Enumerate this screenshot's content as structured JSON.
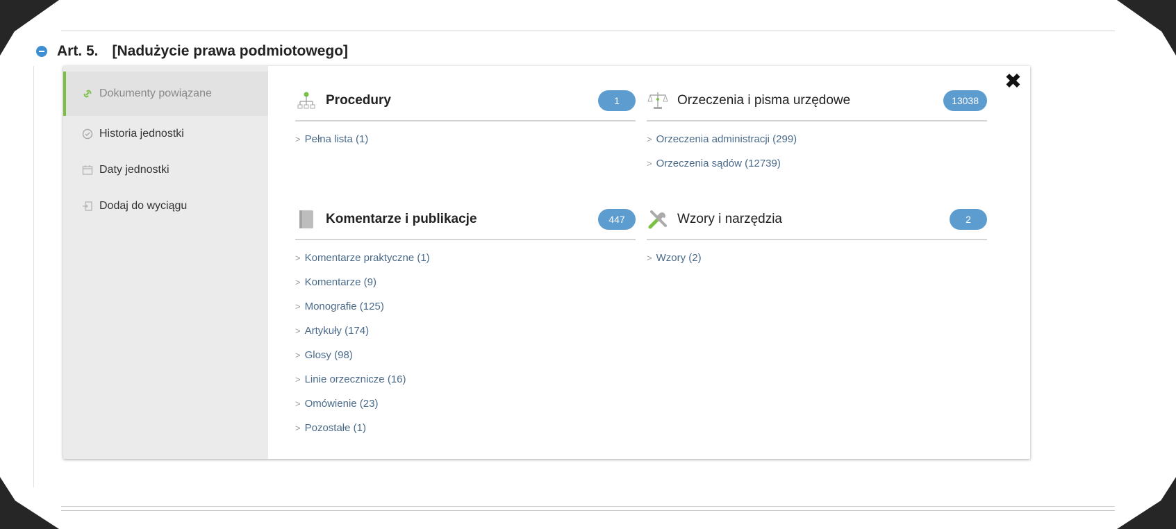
{
  "article": {
    "number": "Art. 5.",
    "title": "[Nadużycie prawa podmiotowego]"
  },
  "sidebar": {
    "items": [
      {
        "label": "Dokumenty powiązane",
        "icon": "link-icon"
      },
      {
        "label": "Historia jednostki",
        "icon": "history-icon"
      },
      {
        "label": "Daty jednostki",
        "icon": "calendar-icon"
      },
      {
        "label": "Dodaj do wyciągu",
        "icon": "add-to-extract-icon"
      }
    ]
  },
  "close_label": "✖",
  "sections": {
    "procedury": {
      "title": "Procedury",
      "count": "1",
      "links": [
        "Pełna lista (1)"
      ]
    },
    "orzeczenia": {
      "title": "Orzeczenia i pisma urzędowe",
      "count": "13038",
      "links": [
        "Orzeczenia administracji (299)",
        "Orzeczenia sądów (12739)"
      ]
    },
    "komentarze": {
      "title": "Komentarze i publikacje",
      "count": "447",
      "links": [
        "Komentarze praktyczne (1)",
        "Komentarze (9)",
        "Monografie (125)",
        "Artykuły (174)",
        "Glosy (98)",
        "Linie orzecznicze (16)",
        "Omówienie (23)",
        "Pozostałe (1)"
      ]
    },
    "wzory": {
      "title": "Wzory i narzędzia",
      "count": "2",
      "links": [
        "Wzory (2)"
      ]
    }
  },
  "colors": {
    "accent_green": "#7ac143",
    "badge_blue": "#5d9ccf",
    "collapse_blue": "#3d8fd1"
  }
}
